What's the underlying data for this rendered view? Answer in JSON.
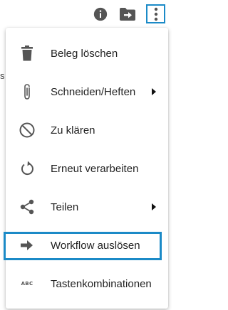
{
  "background": {
    "fragment": "s"
  },
  "toolbar": {
    "buttons": [
      {
        "icon": "info-icon"
      },
      {
        "icon": "move-to-folder-icon"
      },
      {
        "icon": "more-vert-icon"
      }
    ],
    "accent_color": "#1b8ac7"
  },
  "menu": {
    "items": [
      {
        "label": "Beleg löschen",
        "icon": "trash-icon",
        "submenu": false
      },
      {
        "label": "Schneiden/Heften",
        "icon": "paperclip-icon",
        "submenu": true
      },
      {
        "label": "Zu klären",
        "icon": "block-icon",
        "submenu": false
      },
      {
        "label": "Erneut verarbeiten",
        "icon": "refresh-icon",
        "submenu": false
      },
      {
        "label": "Teilen",
        "icon": "share-icon",
        "submenu": true
      },
      {
        "label": "Workflow auslösen",
        "icon": "arrow-right-icon",
        "submenu": false,
        "highlighted": true
      },
      {
        "label": "Tastenkombinationen",
        "icon": "keyboard-abc-icon",
        "icon_text": "ABC",
        "submenu": false
      }
    ]
  }
}
